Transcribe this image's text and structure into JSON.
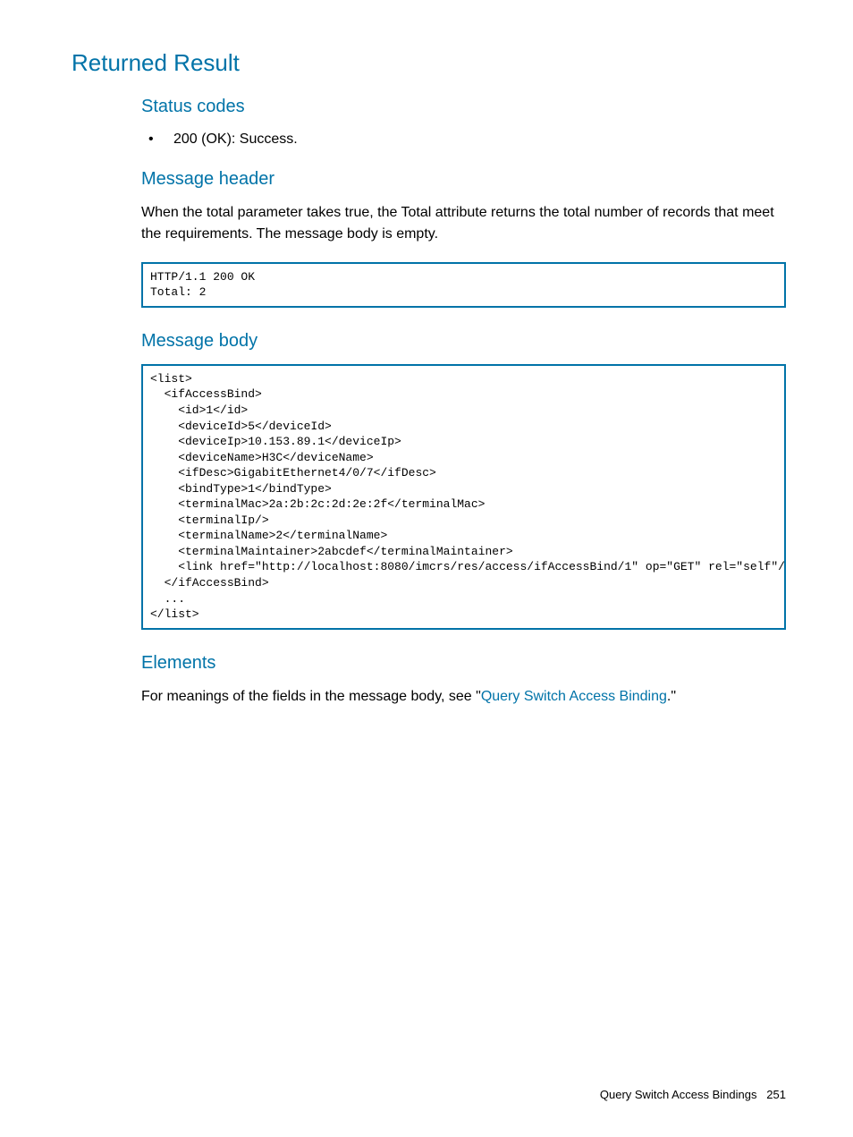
{
  "h1": "Returned Result",
  "sections": {
    "status_codes": {
      "heading": "Status codes",
      "bullet": "200 (OK): Success."
    },
    "message_header": {
      "heading": "Message header",
      "text": "When the total parameter takes true, the Total attribute returns the total number of records that meet the requirements. The message body is empty.",
      "code": "HTTP/1.1 200 OK\nTotal: 2"
    },
    "message_body": {
      "heading": "Message body",
      "code": "<list>\n  <ifAccessBind>\n    <id>1</id>\n    <deviceId>5</deviceId>\n    <deviceIp>10.153.89.1</deviceIp>\n    <deviceName>H3C</deviceName>\n    <ifDesc>GigabitEthernet4/0/7</ifDesc>\n    <bindType>1</bindType>\n    <terminalMac>2a:2b:2c:2d:2e:2f</terminalMac>\n    <terminalIp/>\n    <terminalName>2</terminalName>\n    <terminalMaintainer>2abcdef</terminalMaintainer>\n    <link href=\"http://localhost:8080/imcrs/res/access/ifAccessBind/1\" op=\"GET\" rel=\"self\"/>\n  </ifAccessBind>\n  ...\n</list>"
    },
    "elements": {
      "heading": "Elements",
      "prefix": "For meanings of the fields in the message body, see \"",
      "link": "Query Switch Access Binding",
      "suffix": ".\""
    }
  },
  "footer": {
    "title": "Query Switch Access Bindings",
    "page": "251"
  }
}
